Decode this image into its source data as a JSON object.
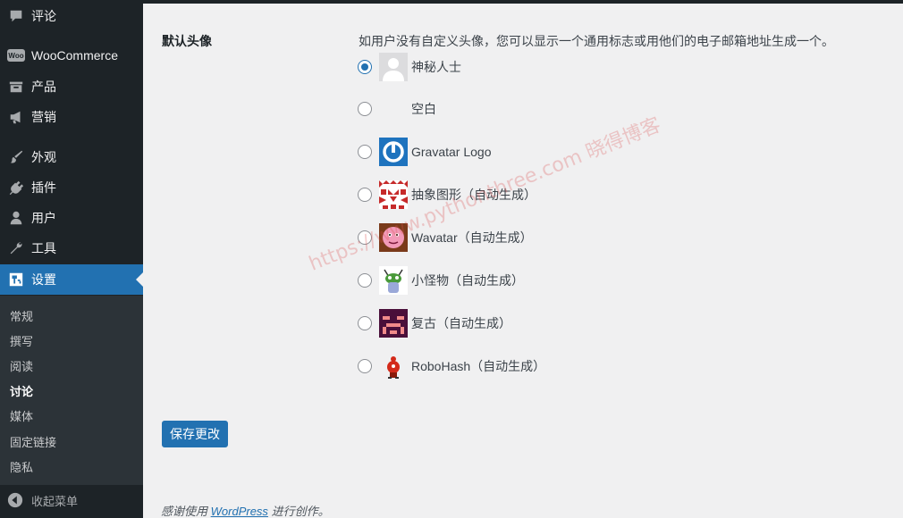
{
  "sidebar": {
    "items": [
      {
        "label": "评论",
        "icon": "comment-icon"
      },
      {
        "label": "WooCommerce",
        "icon": "woocommerce-icon"
      },
      {
        "label": "产品",
        "icon": "archive-icon"
      },
      {
        "label": "营销",
        "icon": "megaphone-icon"
      },
      {
        "label": "外观",
        "icon": "paintbrush-icon"
      },
      {
        "label": "插件",
        "icon": "plugin-icon"
      },
      {
        "label": "用户",
        "icon": "user-icon"
      },
      {
        "label": "工具",
        "icon": "wrench-icon"
      },
      {
        "label": "设置",
        "icon": "settings-icon"
      }
    ],
    "woo_badge": "Woo",
    "submenu": [
      "常规",
      "撰写",
      "阅读",
      "讨论",
      "媒体",
      "固定链接",
      "隐私"
    ],
    "current_submenu": "讨论",
    "collapse_label": "收起菜单"
  },
  "settings": {
    "field_label": "默认头像",
    "description": "如用户没有自定义头像，您可以显示一个通用标志或用他们的电子邮箱地址生成一个。",
    "options": [
      {
        "label": "神秘人士",
        "icon": "mystery-person-avatar-icon",
        "checked": true
      },
      {
        "label": "空白",
        "icon": "blank-avatar",
        "checked": false
      },
      {
        "label": "Gravatar Logo",
        "icon": "gravatar-logo-icon",
        "checked": false
      },
      {
        "label": "抽象图形（自动生成）",
        "icon": "identicon-avatar-icon",
        "checked": false
      },
      {
        "label": "Wavatar（自动生成）",
        "icon": "wavatar-avatar-icon",
        "checked": false
      },
      {
        "label": "小怪物（自动生成）",
        "icon": "monsterid-avatar-icon",
        "checked": false
      },
      {
        "label": "复古（自动生成）",
        "icon": "retro-avatar-icon",
        "checked": false
      },
      {
        "label": "RoboHash（自动生成）",
        "icon": "robohash-avatar-icon",
        "checked": false
      }
    ],
    "save_label": "保存更改"
  },
  "footer": {
    "prefix": "感谢使用",
    "link": "WordPress",
    "suffix": "进行创作。"
  },
  "watermark": "https://www.pythonthree.com  晓得博客",
  "colors": {
    "sidebar_bg": "#1d2327",
    "accent": "#2271b1",
    "content_bg": "#f0f0f1"
  }
}
